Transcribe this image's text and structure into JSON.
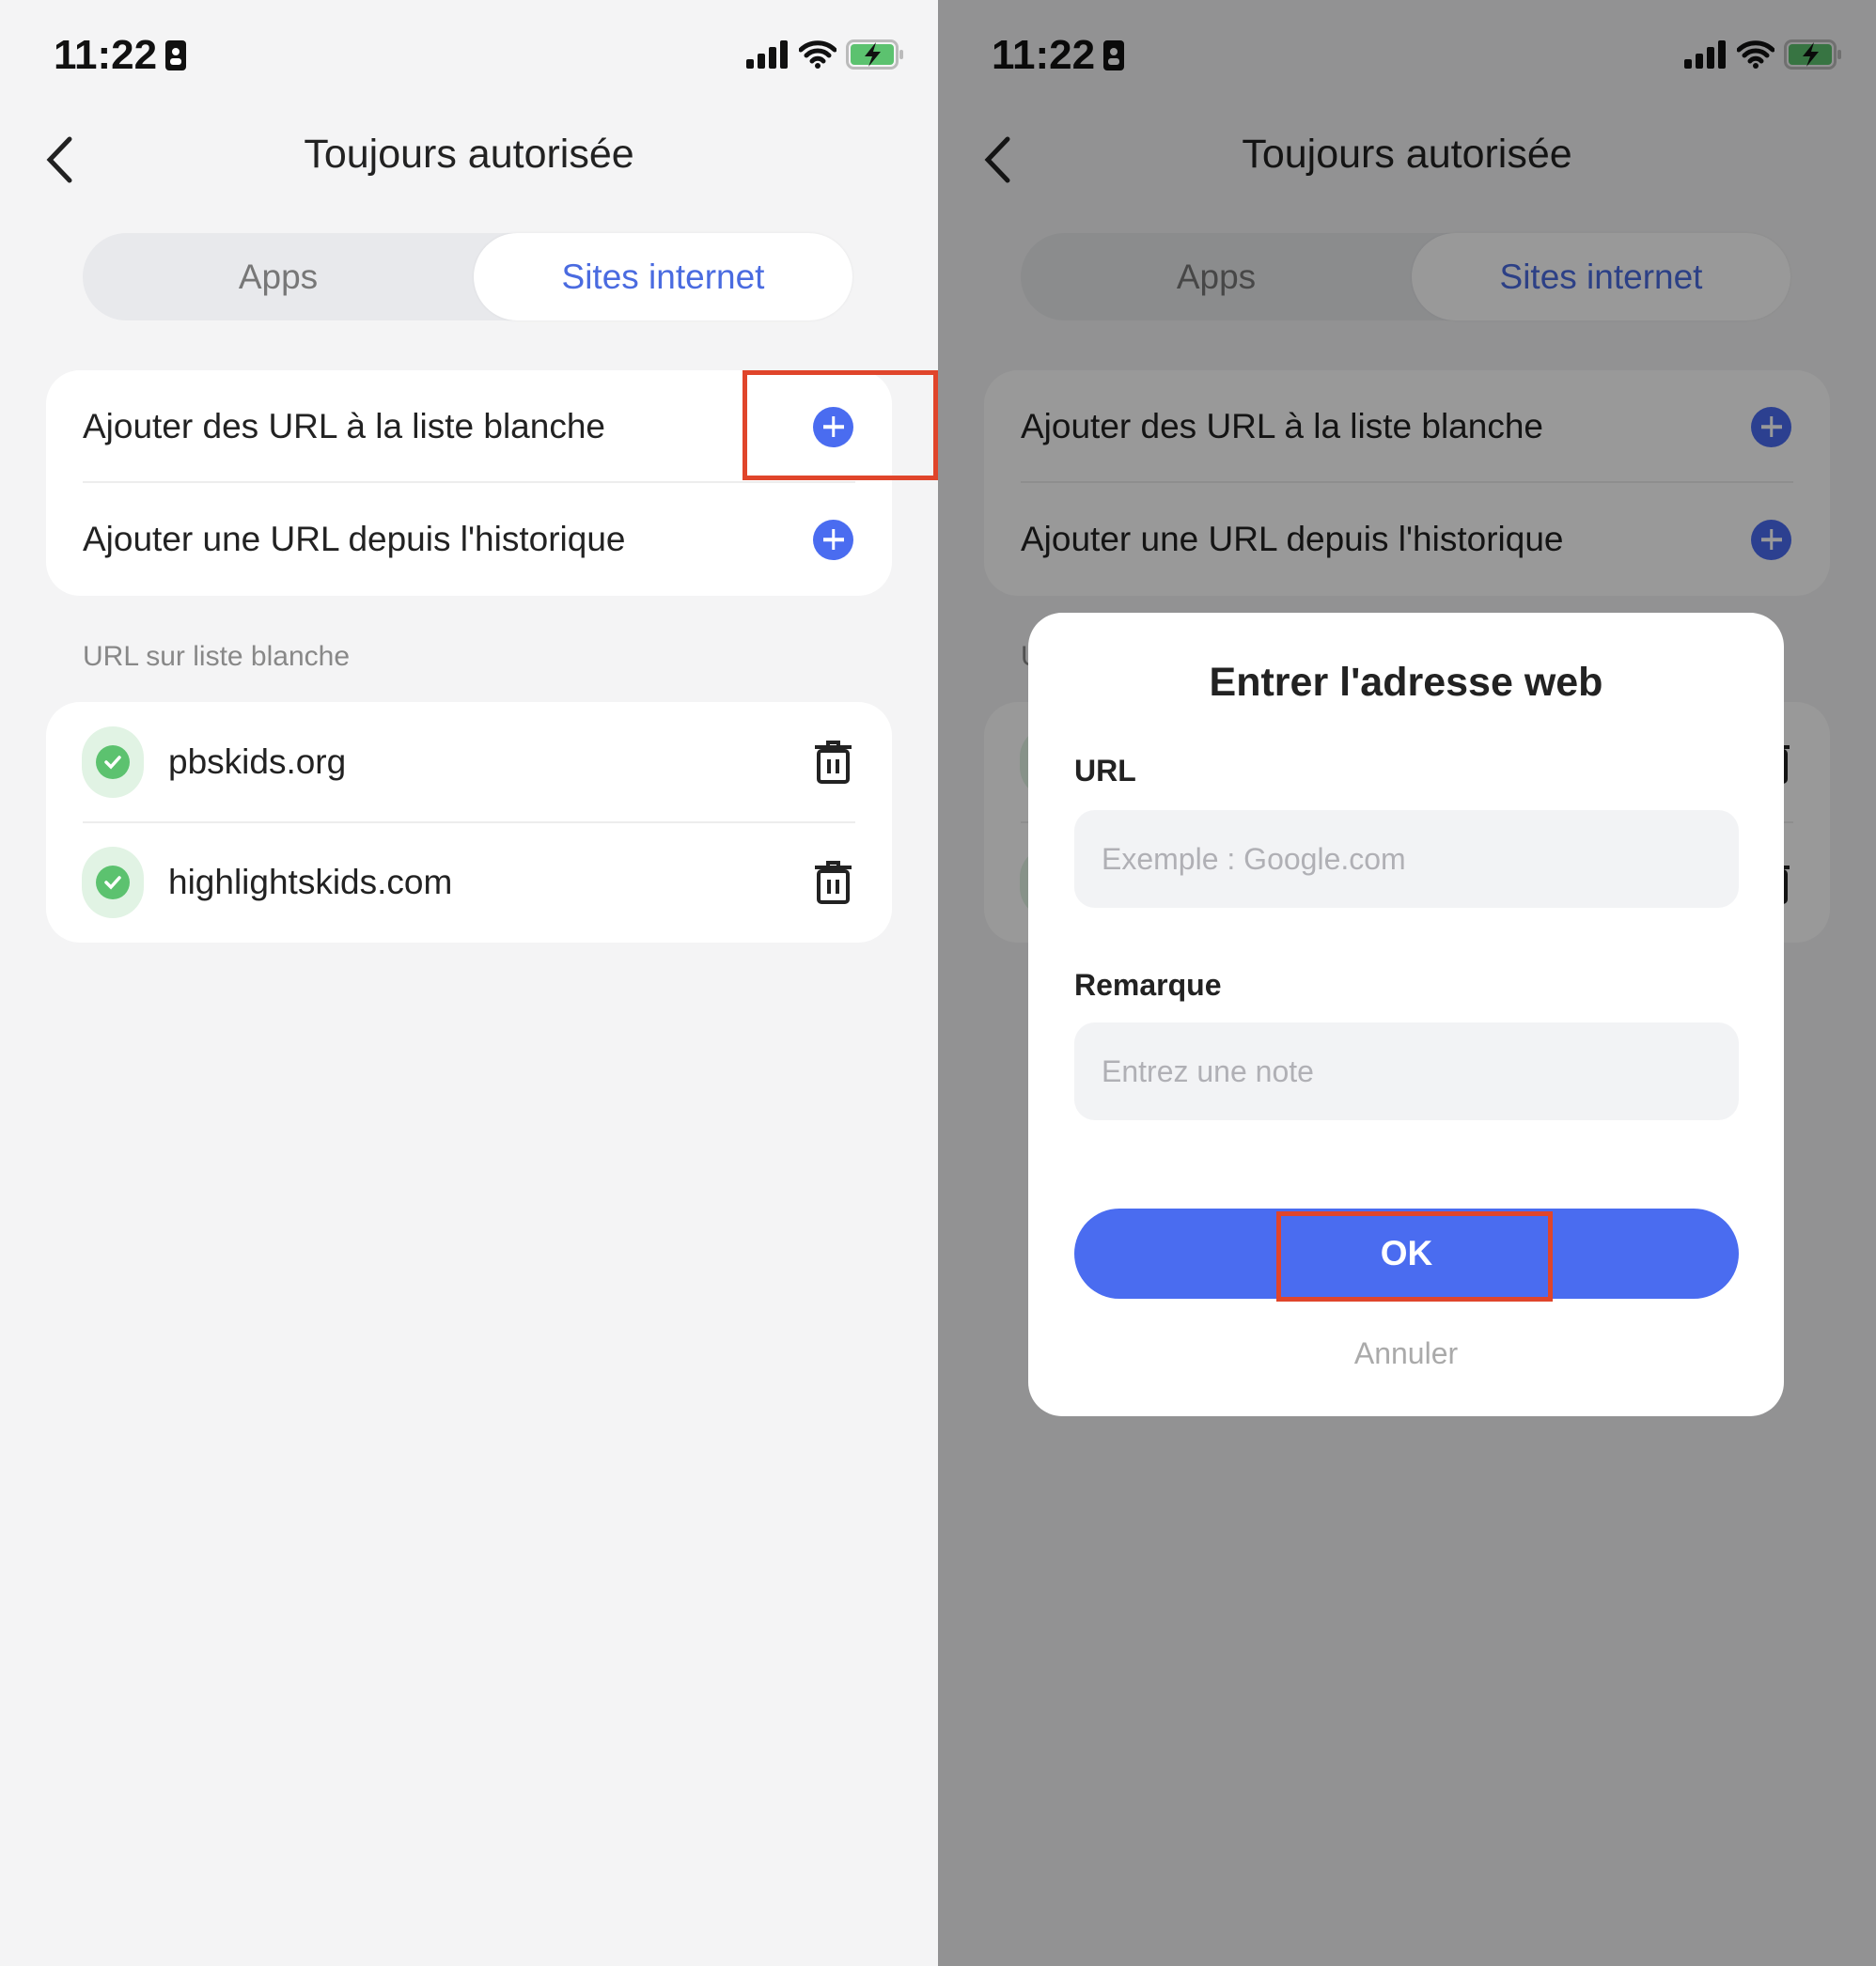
{
  "status_bar": {
    "time": "11:22"
  },
  "header": {
    "title": "Toujours autorisée",
    "back_icon": "chevron-left-icon"
  },
  "tabs": [
    {
      "label": "Apps",
      "selected": false
    },
    {
      "label": "Sites internet",
      "selected": true
    }
  ],
  "actions": [
    {
      "label": "Ajouter des URL à la liste blanche",
      "icon": "plus-circle-icon"
    },
    {
      "label": "Ajouter une URL depuis l'historique",
      "icon": "plus-circle-icon"
    }
  ],
  "whitelist": {
    "section_label": "URL sur liste blanche",
    "items": [
      {
        "url": "pbskids.org"
      },
      {
        "url": "highlightskids.com"
      }
    ]
  },
  "dialog": {
    "title": "Entrer l'adresse web",
    "url_label": "URL",
    "url_placeholder": "Exemple : Google.com",
    "url_value": "",
    "note_label": "Remarque",
    "note_placeholder": "Entrez une note",
    "note_value": "",
    "ok_label": "OK",
    "cancel_label": "Annuler"
  },
  "colors": {
    "accent": "#4a6cf0",
    "highlight": "#e0452b",
    "success": "#5cc26f"
  }
}
